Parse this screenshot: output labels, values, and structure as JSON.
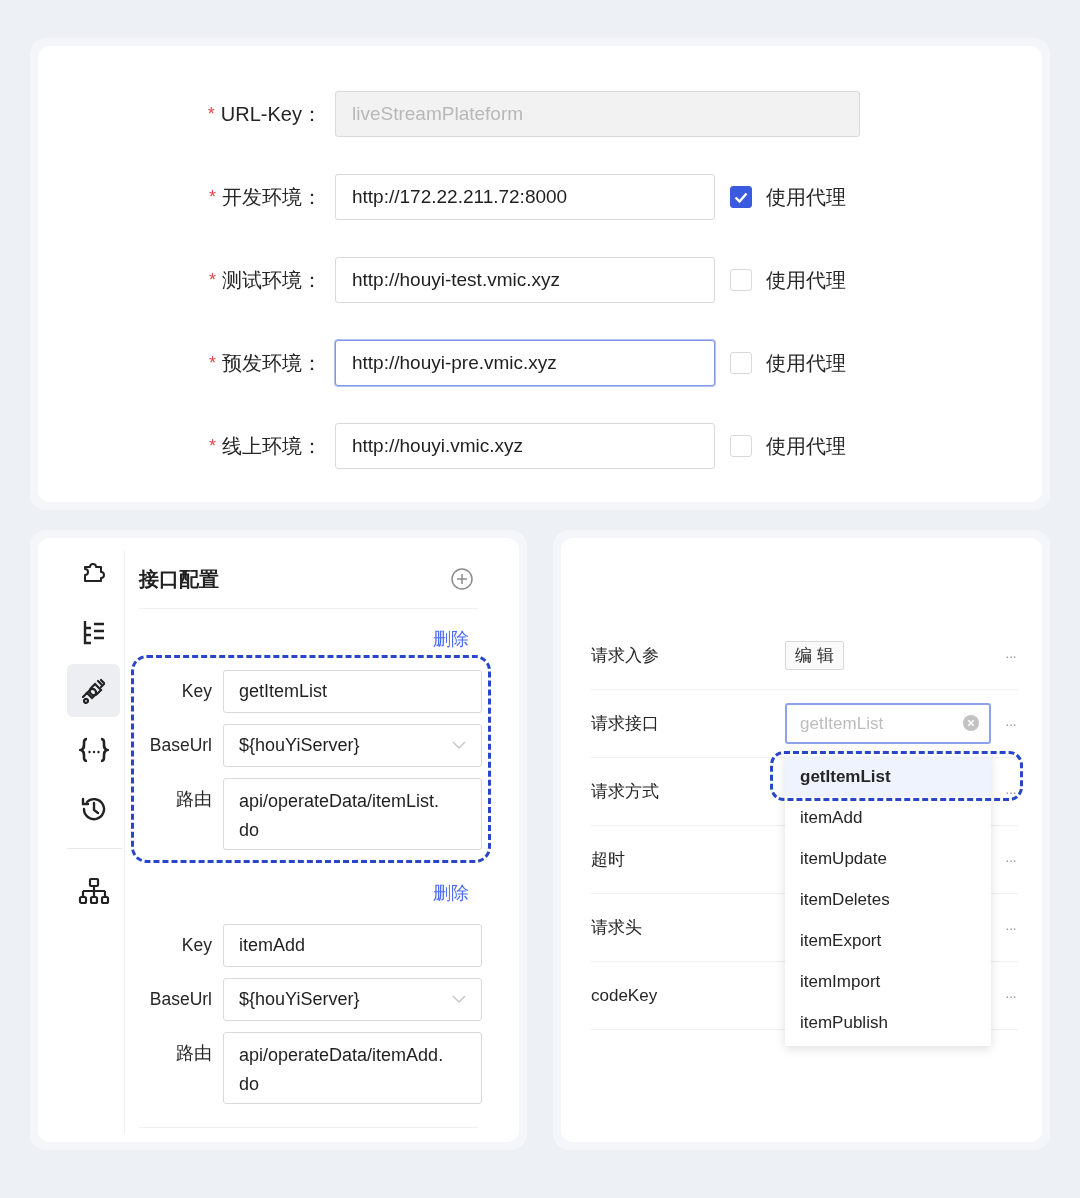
{
  "env_form": {
    "fields": [
      {
        "required_mark": "*",
        "label": "URL-Key：",
        "value": "liveStreamPlateform",
        "disabled": true,
        "focused": false
      },
      {
        "required_mark": "*",
        "label": "开发环境：",
        "value": "http://172.22.211.72:8000",
        "disabled": false,
        "focused": false,
        "proxy": {
          "label": "使用代理",
          "checked": true
        }
      },
      {
        "required_mark": "*",
        "label": "测试环境：",
        "value": "http://houyi-test.vmic.xyz",
        "disabled": false,
        "focused": false,
        "proxy": {
          "label": "使用代理",
          "checked": false
        }
      },
      {
        "required_mark": "*",
        "label": "预发环境：",
        "value": "http://houyi-pre.vmic.xyz",
        "disabled": false,
        "focused": true,
        "proxy": {
          "label": "使用代理",
          "checked": false
        }
      },
      {
        "required_mark": "*",
        "label": "线上环境：",
        "value": "http://houyi.vmic.xyz",
        "disabled": false,
        "focused": false,
        "proxy": {
          "label": "使用代理",
          "checked": false
        }
      }
    ]
  },
  "api_config": {
    "rail": {
      "groups": [
        [
          {
            "selected": false
          },
          {
            "selected": false
          },
          {
            "selected": true
          },
          {
            "selected": false
          },
          {
            "selected": false
          }
        ],
        [
          {
            "selected": false
          }
        ]
      ]
    },
    "title": "接口配置",
    "entries": [
      {
        "delete_label": "删除",
        "highlighted": true,
        "fields": [
          {
            "kind": "input",
            "label": "Key",
            "value": "getItemList"
          },
          {
            "kind": "select",
            "label": "BaseUrl",
            "value": "${houYiServer}"
          },
          {
            "kind": "textarea",
            "label": "路由",
            "value": "api/operateData/itemList.do"
          }
        ]
      },
      {
        "delete_label": "删除",
        "highlighted": false,
        "fields": [
          {
            "kind": "input",
            "label": "Key",
            "value": "itemAdd"
          },
          {
            "kind": "select",
            "label": "BaseUrl",
            "value": "${houYiServer}"
          },
          {
            "kind": "textarea",
            "label": "路由",
            "value": "api/operateData/itemAdd.do"
          }
        ]
      }
    ]
  },
  "request_settings": {
    "rows": [
      {
        "label": "请求入参",
        "kind": "button",
        "value": "编 辑",
        "more": "···"
      },
      {
        "label": "请求接口",
        "kind": "select",
        "placeholder": "getItemList",
        "more": "···",
        "options": [
          {
            "label": "getItemList",
            "selected": true,
            "highlighted": true
          },
          {
            "label": "itemAdd",
            "selected": false,
            "highlighted": false
          },
          {
            "label": "itemUpdate",
            "selected": false,
            "highlighted": false
          },
          {
            "label": "itemDeletes",
            "selected": false,
            "highlighted": false
          },
          {
            "label": "itemExport",
            "selected": false,
            "highlighted": false
          },
          {
            "label": "itemImport",
            "selected": false,
            "highlighted": false
          },
          {
            "label": "itemPublish",
            "selected": false,
            "highlighted": false
          }
        ]
      },
      {
        "label": "请求方式",
        "kind": "none",
        "more": "···"
      },
      {
        "label": "超时",
        "kind": "none",
        "more": "···"
      },
      {
        "label": "请求头",
        "kind": "none",
        "more": "···"
      },
      {
        "label": "codeKey",
        "kind": "none",
        "more": "···"
      }
    ]
  }
}
